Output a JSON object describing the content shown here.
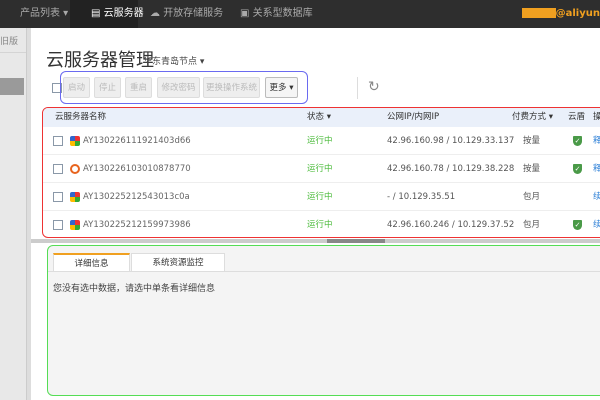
{
  "topnav": {
    "product_list": "产品列表 ▾",
    "tabs": [
      {
        "label": "云服务器",
        "icon": "server-icon"
      },
      {
        "label": "开放存储服务",
        "icon": "cloud-icon"
      },
      {
        "label": "关系型数据库",
        "icon": "database-icon"
      }
    ],
    "user_suffix": "@aliyun"
  },
  "sidebar": {
    "old_version": "旧版"
  },
  "page": {
    "title": "云服务器管理",
    "region": "华东青岛节点 ▾"
  },
  "toolbar": {
    "start": "启动",
    "stop": "停止",
    "restart": "重启",
    "change_password": "修改密码",
    "change_os": "更换操作系统",
    "more": "更多 ▾"
  },
  "table": {
    "headers": [
      "云服务器名称",
      "状态 ▾",
      "公网IP/内网IP",
      "付费方式 ▾",
      "云盾",
      "操"
    ],
    "rows": [
      {
        "name": "AY130226111921403d66",
        "os": "windows",
        "status": "运行中",
        "ip": "42.96.160.98 / 10.129.33.137",
        "billing": "按量",
        "shield": true,
        "action": "释"
      },
      {
        "name": "AY130226103010878770",
        "os": "ubuntu",
        "status": "运行中",
        "ip": "42.96.160.78 / 10.129.38.228",
        "billing": "按量",
        "shield": true,
        "action": "释"
      },
      {
        "name": "AY130225212543013c0a",
        "os": "windows",
        "status": "运行中",
        "ip": "- / 10.129.35.51",
        "billing": "包月",
        "shield": false,
        "action": "续"
      },
      {
        "name": "AY130225212159973986",
        "os": "windows",
        "status": "运行中",
        "ip": "42.96.160.246 / 10.129.37.52",
        "billing": "包月",
        "shield": true,
        "action": "续"
      }
    ]
  },
  "detail": {
    "tabs": [
      "详细信息",
      "系统资源监控"
    ],
    "message": "您没有选中数据，请选中单条看详细信息"
  },
  "colors": {
    "status_running": "#4cbb3c",
    "accent": "#f0a020",
    "link": "#2a7ed6"
  }
}
